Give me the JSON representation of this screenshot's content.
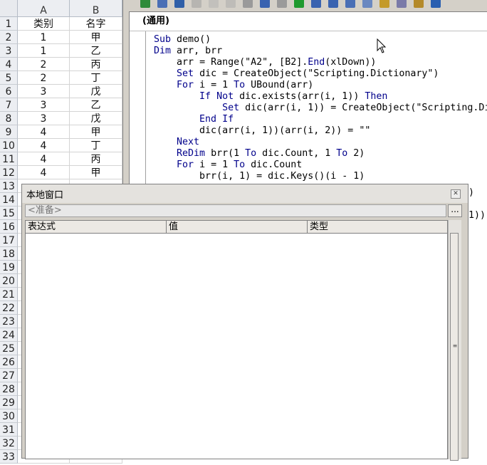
{
  "sheet": {
    "columns": [
      "A",
      "B"
    ],
    "rows": [
      {
        "num": "1",
        "a": "类别",
        "b": "名字"
      },
      {
        "num": "2",
        "a": "1",
        "b": "甲"
      },
      {
        "num": "3",
        "a": "1",
        "b": "乙"
      },
      {
        "num": "4",
        "a": "2",
        "b": "丙"
      },
      {
        "num": "5",
        "a": "2",
        "b": "丁"
      },
      {
        "num": "6",
        "a": "3",
        "b": "戊"
      },
      {
        "num": "7",
        "a": "3",
        "b": "乙"
      },
      {
        "num": "8",
        "a": "3",
        "b": "戊"
      },
      {
        "num": "9",
        "a": "4",
        "b": "甲"
      },
      {
        "num": "10",
        "a": "4",
        "b": "丁"
      },
      {
        "num": "11",
        "a": "4",
        "b": "丙"
      },
      {
        "num": "12",
        "a": "4",
        "b": "甲"
      },
      {
        "num": "13",
        "a": "",
        "b": ""
      },
      {
        "num": "14",
        "a": "",
        "b": ""
      },
      {
        "num": "15",
        "a": "",
        "b": ""
      },
      {
        "num": "16",
        "a": "",
        "b": ""
      },
      {
        "num": "17",
        "a": "",
        "b": ""
      },
      {
        "num": "18",
        "a": "",
        "b": ""
      },
      {
        "num": "19",
        "a": "",
        "b": ""
      },
      {
        "num": "20",
        "a": "",
        "b": ""
      },
      {
        "num": "21",
        "a": "",
        "b": ""
      },
      {
        "num": "22",
        "a": "",
        "b": ""
      },
      {
        "num": "23",
        "a": "",
        "b": ""
      },
      {
        "num": "24",
        "a": "",
        "b": ""
      },
      {
        "num": "25",
        "a": "",
        "b": ""
      },
      {
        "num": "26",
        "a": "",
        "b": ""
      },
      {
        "num": "27",
        "a": "",
        "b": ""
      },
      {
        "num": "28",
        "a": "",
        "b": ""
      },
      {
        "num": "29",
        "a": "",
        "b": ""
      },
      {
        "num": "30",
        "a": "",
        "b": ""
      },
      {
        "num": "31",
        "a": "",
        "b": ""
      },
      {
        "num": "32",
        "a": "",
        "b": ""
      },
      {
        "num": "33",
        "a": "",
        "b": ""
      }
    ]
  },
  "vbe": {
    "toolbar_icons": [
      "excel-icon",
      "insert-icon",
      "save-icon",
      "cut-icon",
      "copy-icon",
      "paste-icon",
      "find-icon",
      "undo-icon",
      "redo-icon",
      "run-icon",
      "break-icon",
      "reset-icon",
      "design-mode-icon",
      "project-explorer-icon",
      "properties-icon",
      "object-browser-icon",
      "toolbox-icon",
      "help-icon"
    ],
    "object_dropdown": "(通用)",
    "code_lines": [
      "Sub demo()",
      "Dim arr, brr",
      "    arr = Range(\"A2\", [B2].End(xlDown))",
      "    Set dic = CreateObject(\"Scripting.Dictionary\")",
      "    For i = 1 To UBound(arr)",
      "        If Not dic.exists(arr(i, 1)) Then",
      "            Set dic(arr(i, 1)) = CreateObject(\"Scripting.Di",
      "        End If",
      "        dic(arr(i, 1))(arr(i, 2)) = \"\"",
      "    Next",
      "    ReDim brr(1 To dic.Count, 1 To 2)",
      "    For i = 1 To dic.Count",
      "        brr(i, 1) = dic.Keys()(i - 1)"
    ],
    "code_tail_fragments": [
      "\")",
      "(1))"
    ]
  },
  "locals": {
    "title": "本地窗口",
    "context": "<准备>",
    "browse_button": "...",
    "columns": [
      "表达式",
      "值",
      "类型"
    ]
  },
  "colors": {
    "keyword": "#00008b",
    "ide_background": "#d4d0c8"
  }
}
